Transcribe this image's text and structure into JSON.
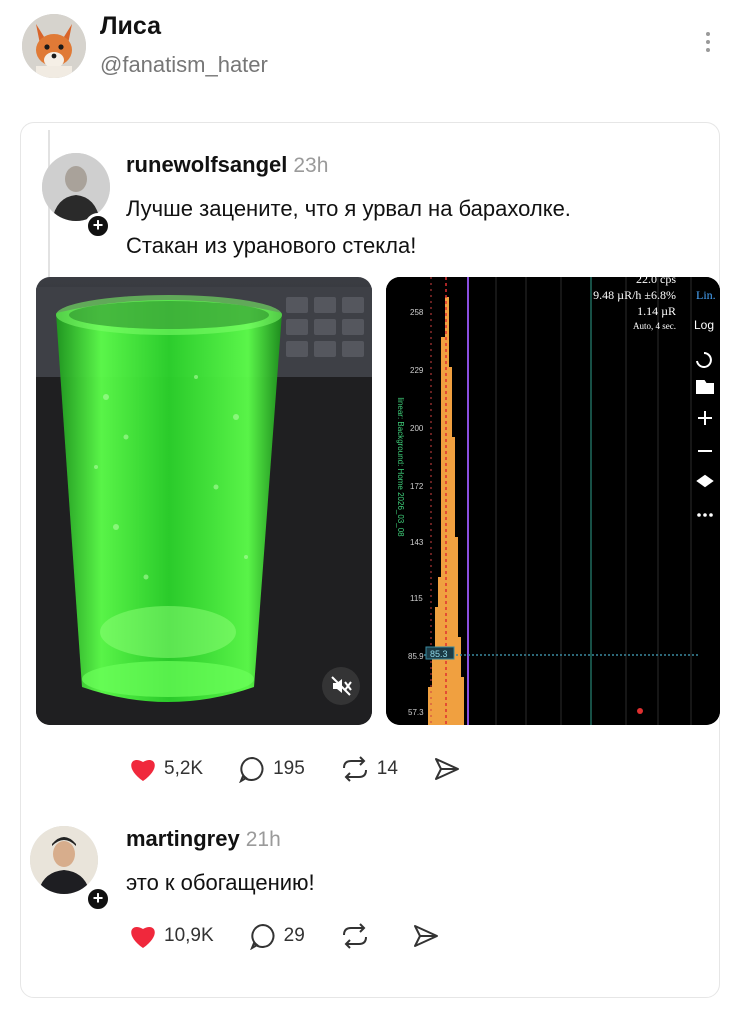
{
  "header": {
    "name": "Лиса",
    "handle": "@fanatism_hater"
  },
  "post": {
    "username": "runewolfsangel",
    "time": "23h",
    "text_line1": "Лучше зацените, что я урвал на барахолке.",
    "text_line2": "Стакан из уранового стекла!",
    "screen": {
      "cps_partial": "22.0 cps",
      "dose_rate": "9.48 µR/h ±6.8%",
      "scale_mode": "Lin.",
      "dose_total": "1.14 µR",
      "interval": "Auto, 4 sec.",
      "log_mode": "Log",
      "side_label": "linear: Background: Home 2026_03_08",
      "y_ticks": [
        "258",
        "229",
        "200",
        "172",
        "143",
        "115",
        "85.9",
        "57.3"
      ],
      "cursor_value": "85.3"
    },
    "likes": "5,2K",
    "comments": "195",
    "reposts": "14"
  },
  "reply": {
    "username": "martingrey",
    "time": "21h",
    "text": "это к обогащению!",
    "likes": "10,9K",
    "comments": "29"
  },
  "colors": {
    "like_red": "#f0283c",
    "glass_green": "#3cff40",
    "spectrum_orange": "#f0a040"
  }
}
